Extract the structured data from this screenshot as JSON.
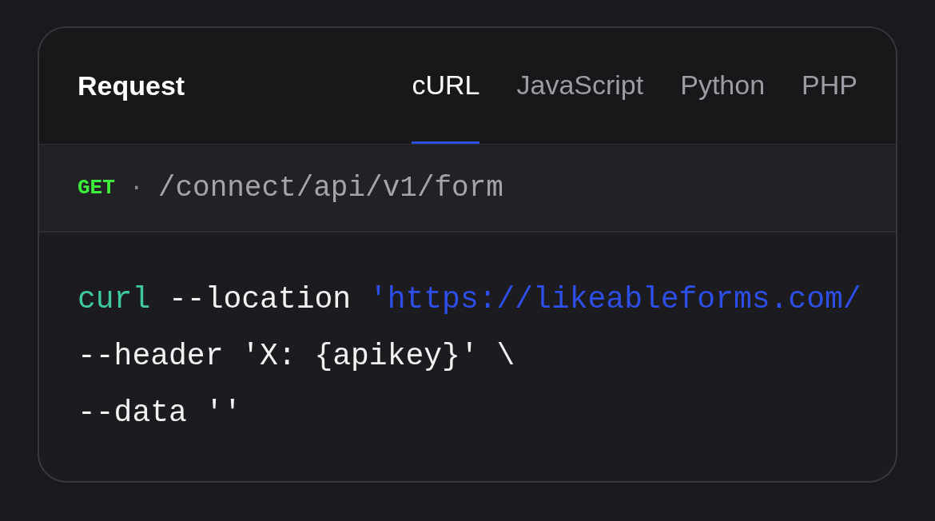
{
  "panel": {
    "title": "Request",
    "tabs": [
      {
        "label": "cURL",
        "selected": true
      },
      {
        "label": "JavaScript",
        "selected": false
      },
      {
        "label": "Python",
        "selected": false
      },
      {
        "label": "PHP",
        "selected": false
      }
    ],
    "endpoint": {
      "method": "GET",
      "separator": "·",
      "path": "/connect/api/v1/form"
    },
    "code_lines": [
      [
        {
          "text": "curl",
          "kind": "command"
        },
        {
          "text": " --location ",
          "kind": "plain"
        },
        {
          "text": "'https://likeableforms.com/",
          "kind": "string"
        }
      ],
      [
        {
          "text": "--header 'X: {apikey}' \\",
          "kind": "plain"
        }
      ],
      [
        {
          "text": "--data ''",
          "kind": "plain"
        }
      ]
    ]
  }
}
